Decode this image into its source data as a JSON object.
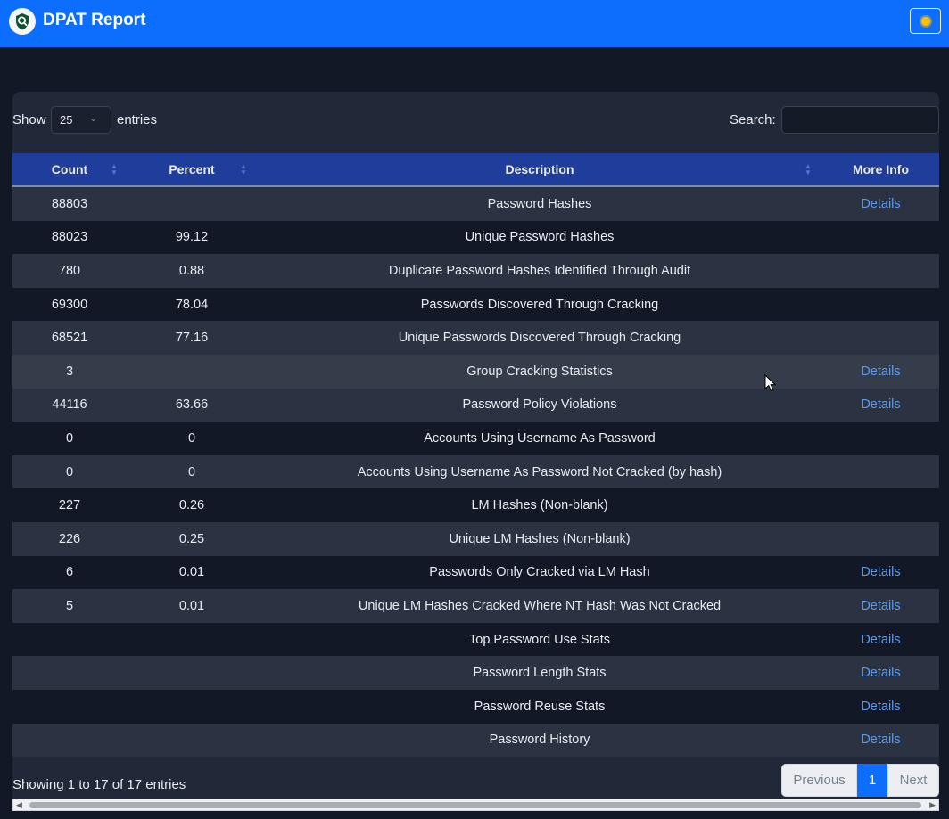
{
  "header": {
    "title": "DPAT Report",
    "logo_icon": "magnifier-shield-icon",
    "theme_toggle_icon": "sun-icon"
  },
  "controls": {
    "show_label": "Show",
    "page_length": "25",
    "entries_label": "entries",
    "search_label": "Search:",
    "search_value": ""
  },
  "table": {
    "columns": [
      "Count",
      "Percent",
      "Description",
      "More Info"
    ],
    "rows": [
      {
        "count": "88803",
        "percent": "",
        "description": "Password Hashes",
        "more_info": "Details"
      },
      {
        "count": "88023",
        "percent": "99.12",
        "description": "Unique Password Hashes",
        "more_info": ""
      },
      {
        "count": "780",
        "percent": "0.88",
        "description": "Duplicate Password Hashes Identified Through Audit",
        "more_info": ""
      },
      {
        "count": "69300",
        "percent": "78.04",
        "description": "Passwords Discovered Through Cracking",
        "more_info": ""
      },
      {
        "count": "68521",
        "percent": "77.16",
        "description": "Unique Passwords Discovered Through Cracking",
        "more_info": ""
      },
      {
        "count": "3",
        "percent": "",
        "description": "Group Cracking Statistics",
        "more_info": "Details"
      },
      {
        "count": "44116",
        "percent": "63.66",
        "description": "Password Policy Violations",
        "more_info": "Details"
      },
      {
        "count": "0",
        "percent": "0",
        "description": "Accounts Using Username As Password",
        "more_info": ""
      },
      {
        "count": "0",
        "percent": "0",
        "description": "Accounts Using Username As Password Not Cracked (by hash)",
        "more_info": ""
      },
      {
        "count": "227",
        "percent": "0.26",
        "description": "LM Hashes (Non-blank)",
        "more_info": ""
      },
      {
        "count": "226",
        "percent": "0.25",
        "description": "Unique LM Hashes (Non-blank)",
        "more_info": ""
      },
      {
        "count": "6",
        "percent": "0.01",
        "description": "Passwords Only Cracked via LM Hash",
        "more_info": "Details"
      },
      {
        "count": "5",
        "percent": "0.01",
        "description": "Unique LM Hashes Cracked Where NT Hash Was Not Cracked",
        "more_info": "Details"
      },
      {
        "count": "",
        "percent": "",
        "description": "Top Password Use Stats",
        "more_info": "Details"
      },
      {
        "count": "",
        "percent": "",
        "description": "Password Length Stats",
        "more_info": "Details"
      },
      {
        "count": "",
        "percent": "",
        "description": "Password Reuse Stats",
        "more_info": "Details"
      },
      {
        "count": "",
        "percent": "",
        "description": "Password History",
        "more_info": "Details"
      }
    ]
  },
  "footer": {
    "info": "Showing 1 to 17 of 17 entries",
    "previous": "Previous",
    "current_page": "1",
    "next": "Next"
  },
  "colors": {
    "navbar": "#0d6efd",
    "header_row": "#1f3d9a",
    "link": "#5b9bf0",
    "background": "#121826"
  }
}
